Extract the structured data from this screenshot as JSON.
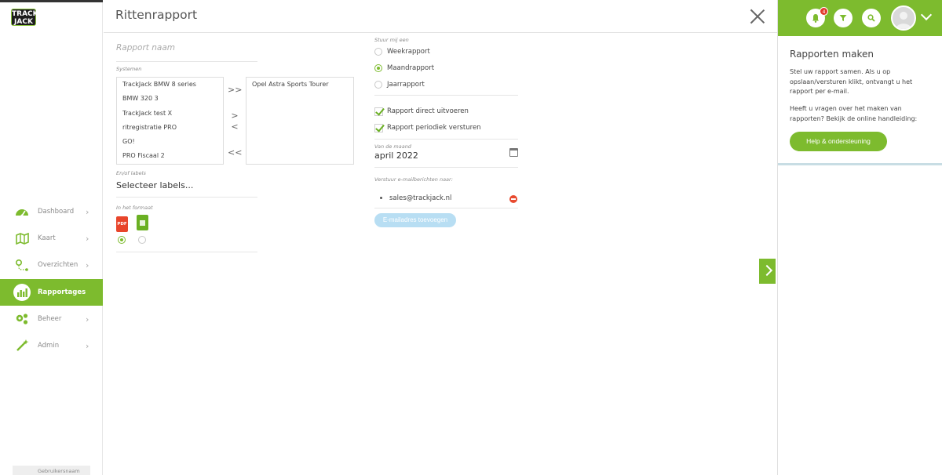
{
  "brand": {
    "logo_text": "TRACK JACK",
    "accent": "#7dbb2e"
  },
  "sidebar": {
    "items": [
      {
        "label": "Dashboard",
        "icon": "dashboard-gauge-icon",
        "active": false
      },
      {
        "label": "Kaart",
        "icon": "map-icon",
        "active": false
      },
      {
        "label": "Overzichten",
        "icon": "route-icon",
        "active": false
      },
      {
        "label": "Rapportages",
        "icon": "bar-chart-icon",
        "active": true
      },
      {
        "label": "Beheer",
        "icon": "gears-icon",
        "active": false
      },
      {
        "label": "Admin",
        "icon": "magic-wand-icon",
        "active": false
      }
    ],
    "user_label": "Gebruikersnaam"
  },
  "modal": {
    "title": "Rittenrapport",
    "report_name_placeholder": "Rapport naam",
    "systems_label": "Systemen",
    "systems_available": [
      "TrackJack BMW 8 series",
      "BMW 320 3",
      "TrackJack test X",
      "ritregistratie PRO",
      "GO!",
      "PRO Fiscaal 2"
    ],
    "systems_selected": [
      "Opel Astra Sports Tourer"
    ],
    "move_all_right": ">>",
    "move_right": ">",
    "move_left": "<",
    "move_all_left": "<<",
    "labels_label": "En/of labels",
    "labels_value": "Selecteer labels...",
    "format_label": "In het formaat",
    "formats": [
      {
        "name": "PDF",
        "selected": true,
        "color": "#e8452b"
      },
      {
        "name": "XLS",
        "selected": false,
        "color": "#6ab023"
      }
    ],
    "send_label": "Stuur mij een",
    "frequency_options": [
      {
        "label": "Weekrapport",
        "selected": false
      },
      {
        "label": "Maandrapport",
        "selected": true
      },
      {
        "label": "Jaarrapport",
        "selected": false
      }
    ],
    "checkboxes": [
      {
        "label": "Rapport direct uitvoeren",
        "checked": true
      },
      {
        "label": "Rapport periodiek versturen",
        "checked": true
      }
    ],
    "month_label": "Van de maand",
    "month_value": "april 2022",
    "email_label": "Verstuur e-mailberichten naar:",
    "emails": [
      "sales@trackjack.nl"
    ],
    "add_email_label": "E-mailadres toevoegen"
  },
  "right_panel": {
    "notification_count": "4",
    "title": "Rapporten maken",
    "paragraph1": "Stel uw rapport samen. Als u op opslaan/versturen klikt, ontvangt u het rapport per e-mail.",
    "paragraph2": "Heeft u vragen over het maken van rapporten? Bekijk de online handleiding:",
    "help_button": "Help & ondersteuning"
  }
}
